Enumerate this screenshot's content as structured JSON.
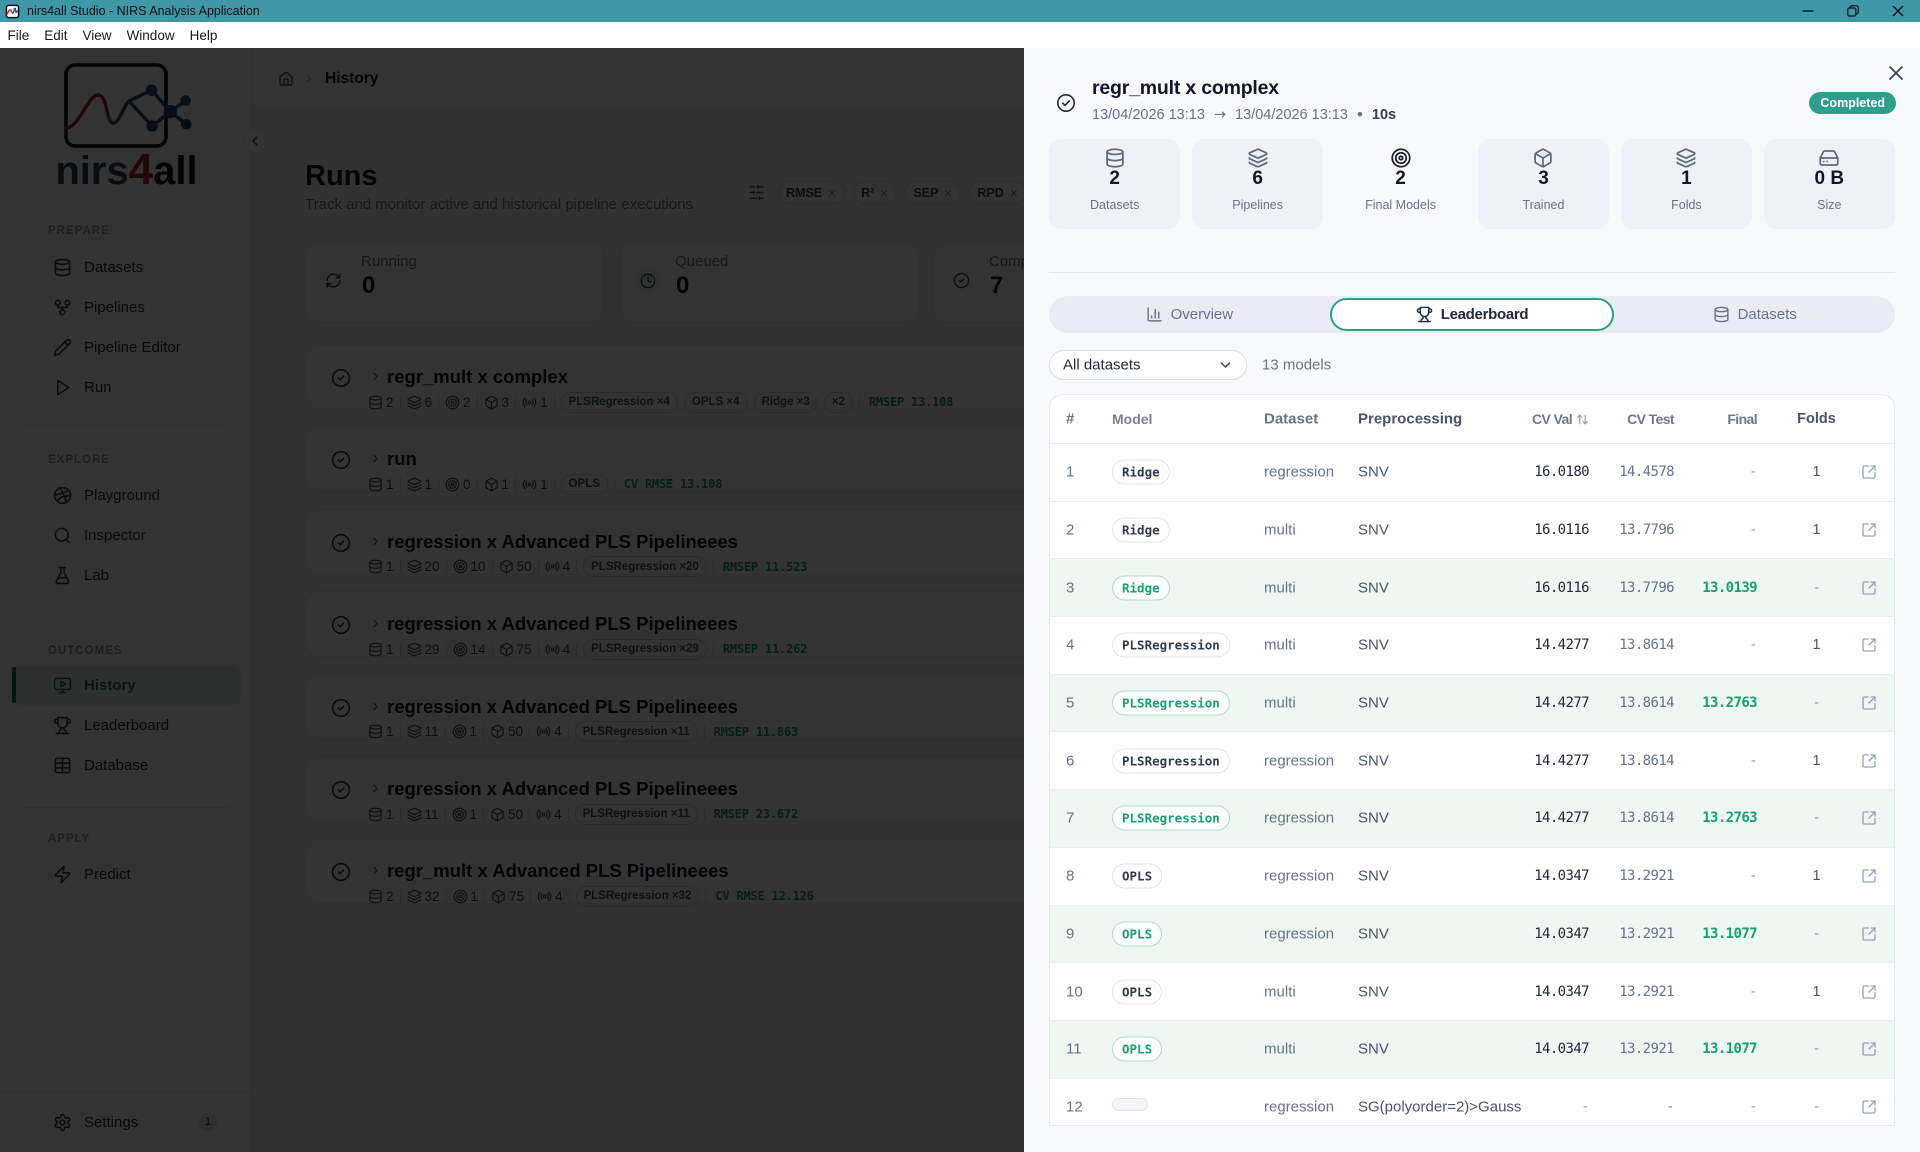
{
  "window": {
    "title": "nirs4all Studio - NIRS Analysis Application",
    "menu": [
      "File",
      "Edit",
      "View",
      "Window",
      "Help"
    ],
    "controls": [
      "minimize",
      "maximize",
      "close"
    ]
  },
  "sidebar": {
    "logo": {
      "part1": "nirs",
      "part2": "4",
      "part3": "all"
    },
    "sections": [
      {
        "label": "PREPARE",
        "items": [
          {
            "label": "Datasets",
            "icon": "database"
          },
          {
            "label": "Pipelines",
            "icon": "workflow"
          },
          {
            "label": "Pipeline Editor",
            "icon": "pencil"
          },
          {
            "label": "Run",
            "icon": "play"
          }
        ]
      },
      {
        "label": "EXPLORE",
        "items": [
          {
            "label": "Playground",
            "icon": "sphere"
          },
          {
            "label": "Inspector",
            "icon": "search"
          },
          {
            "label": "Lab",
            "icon": "flask"
          }
        ]
      },
      {
        "label": "OUTCOMES",
        "items": [
          {
            "label": "History",
            "icon": "monitor-play",
            "active": true
          },
          {
            "label": "Leaderboard",
            "icon": "trophy"
          },
          {
            "label": "Database",
            "icon": "table"
          }
        ]
      },
      {
        "label": "APPLY",
        "items": [
          {
            "label": "Predict",
            "icon": "zap"
          }
        ]
      }
    ],
    "settings": {
      "label": "Settings",
      "badge": "1",
      "icon": "gear"
    }
  },
  "breadcrumb": {
    "page": "History"
  },
  "runs_page": {
    "title": "Runs",
    "subtitle": "Track and monitor active and historical pipeline executions",
    "filter_chips": [
      {
        "label": "RMSE"
      },
      {
        "label": "R²"
      },
      {
        "label": "SEP"
      },
      {
        "label": "RPD"
      }
    ],
    "summary_cards": [
      {
        "label": "Running",
        "value": "0",
        "icon": "refresh"
      },
      {
        "label": "Queued",
        "value": "0",
        "icon": "clock",
        "circled": true
      },
      {
        "label": "Completed",
        "value": "7",
        "icon": "check-circle"
      }
    ],
    "runs": [
      {
        "title": "regr_mult x complex",
        "stats": [
          "2",
          "6",
          "2",
          "3",
          "1"
        ],
        "chips": [
          "PLSRegression ×4",
          "OPLS ×4",
          "Ridge ×3",
          "×2"
        ],
        "metric": "RMSEP 13.108"
      },
      {
        "title": "run",
        "stats": [
          "1",
          "1",
          "0",
          "1",
          "1"
        ],
        "chips": [
          "OPLS"
        ],
        "metric": "CV RMSE 13.108"
      },
      {
        "title": "regression x Advanced PLS Pipelineees",
        "stats": [
          "1",
          "20",
          "10",
          "50",
          "4"
        ],
        "chips": [
          "PLSRegression ×20"
        ],
        "metric": "RMSEP 11.523"
      },
      {
        "title": "regression x Advanced PLS Pipelineees",
        "stats": [
          "1",
          "29",
          "14",
          "75",
          "4"
        ],
        "chips": [
          "PLSRegression ×29"
        ],
        "metric": "RMSEP 11.262"
      },
      {
        "title": "regression x Advanced PLS Pipelineees",
        "stats": [
          "1",
          "11",
          "1",
          "50",
          "4"
        ],
        "chips": [
          "PLSRegression ×11"
        ],
        "metric": "RMSEP 11.863"
      },
      {
        "title": "regression x Advanced PLS Pipelineees",
        "stats": [
          "1",
          "11",
          "1",
          "50",
          "4"
        ],
        "chips": [
          "PLSRegression ×11"
        ],
        "metric": "RMSEP 23.672"
      },
      {
        "title": "regr_mult x Advanced PLS Pipelineees",
        "stats": [
          "2",
          "32",
          "1",
          "75",
          "4"
        ],
        "chips": [
          "PLSRegression ×32"
        ],
        "metric": "CV RMSE 12.126"
      }
    ],
    "run_stat_icons": [
      "database",
      "layers",
      "target",
      "box",
      "radio"
    ]
  },
  "modal": {
    "title": "regr_mult x complex",
    "started": "13/04/2026 13:13",
    "ended": "13/04/2026 13:13",
    "duration": "10s",
    "arrow": "→",
    "separator": "•",
    "status": "Completed",
    "stats": [
      {
        "value": "2",
        "label": "Datasets",
        "icon": "database"
      },
      {
        "value": "6",
        "label": "Pipelines",
        "icon": "layers"
      },
      {
        "value": "2",
        "label": "Final Models",
        "icon": "target",
        "plain": true
      },
      {
        "value": "3",
        "label": "Trained",
        "icon": "box"
      },
      {
        "value": "1",
        "label": "Folds",
        "icon": "layers"
      },
      {
        "value": "0 B",
        "label": "Size",
        "icon": "drive"
      }
    ],
    "tabs": [
      {
        "label": "Overview",
        "icon": "chart"
      },
      {
        "label": "Leaderboard",
        "icon": "trophy",
        "active": true
      },
      {
        "label": "Datasets",
        "icon": "database"
      }
    ],
    "dataset_filter": "All datasets",
    "models_count": "13 models",
    "table": {
      "columns": {
        "rank": "#",
        "model": "Model",
        "dataset": "Dataset",
        "preprocessing": "Preprocessing",
        "cv_val": "CV Val",
        "cv_test": "CV Test",
        "final": "Final",
        "folds": "Folds"
      },
      "rows": [
        {
          "rank": "1",
          "model": "Ridge",
          "dataset": "regression",
          "preprocessing": "SNV",
          "cv_val": "16.0180",
          "cv_test": "14.4578",
          "final": "-",
          "folds": "1",
          "highlight": false
        },
        {
          "rank": "2",
          "model": "Ridge",
          "dataset": "multi",
          "preprocessing": "SNV",
          "cv_val": "16.0116",
          "cv_test": "13.7796",
          "final": "-",
          "folds": "1",
          "highlight": false
        },
        {
          "rank": "3",
          "model": "Ridge",
          "dataset": "multi",
          "preprocessing": "SNV",
          "cv_val": "16.0116",
          "cv_test": "13.7796",
          "final": "13.0139",
          "folds": "-",
          "highlight": true
        },
        {
          "rank": "4",
          "model": "PLSRegression",
          "dataset": "multi",
          "preprocessing": "SNV",
          "cv_val": "14.4277",
          "cv_test": "13.8614",
          "final": "-",
          "folds": "1",
          "highlight": false
        },
        {
          "rank": "5",
          "model": "PLSRegression",
          "dataset": "multi",
          "preprocessing": "SNV",
          "cv_val": "14.4277",
          "cv_test": "13.8614",
          "final": "13.2763",
          "folds": "-",
          "highlight": true
        },
        {
          "rank": "6",
          "model": "PLSRegression",
          "dataset": "regression",
          "preprocessing": "SNV",
          "cv_val": "14.4277",
          "cv_test": "13.8614",
          "final": "-",
          "folds": "1",
          "highlight": false
        },
        {
          "rank": "7",
          "model": "PLSRegression",
          "dataset": "regression",
          "preprocessing": "SNV",
          "cv_val": "14.4277",
          "cv_test": "13.8614",
          "final": "13.2763",
          "folds": "-",
          "highlight": true
        },
        {
          "rank": "8",
          "model": "OPLS",
          "dataset": "regression",
          "preprocessing": "SNV",
          "cv_val": "14.0347",
          "cv_test": "13.2921",
          "final": "-",
          "folds": "1",
          "highlight": false
        },
        {
          "rank": "9",
          "model": "OPLS",
          "dataset": "regression",
          "preprocessing": "SNV",
          "cv_val": "14.0347",
          "cv_test": "13.2921",
          "final": "13.1077",
          "folds": "-",
          "highlight": true
        },
        {
          "rank": "10",
          "model": "OPLS",
          "dataset": "multi",
          "preprocessing": "SNV",
          "cv_val": "14.0347",
          "cv_test": "13.2921",
          "final": "-",
          "folds": "1",
          "highlight": false
        },
        {
          "rank": "11",
          "model": "OPLS",
          "dataset": "multi",
          "preprocessing": "SNV",
          "cv_val": "14.0347",
          "cv_test": "13.2921",
          "final": "13.1077",
          "folds": "-",
          "highlight": true
        },
        {
          "rank": "12",
          "model": "",
          "dataset": "regression",
          "preprocessing": "SG(polyorder=2)>Gauss",
          "cv_val": "-",
          "cv_test": "-",
          "final": "-",
          "folds": "-",
          "highlight": false
        }
      ]
    }
  },
  "colors": {
    "titlebar": "#4097a7",
    "accent_green": "#2f9e8a",
    "value_green": "#16a36b",
    "highlight_row": "#eef7f2"
  }
}
